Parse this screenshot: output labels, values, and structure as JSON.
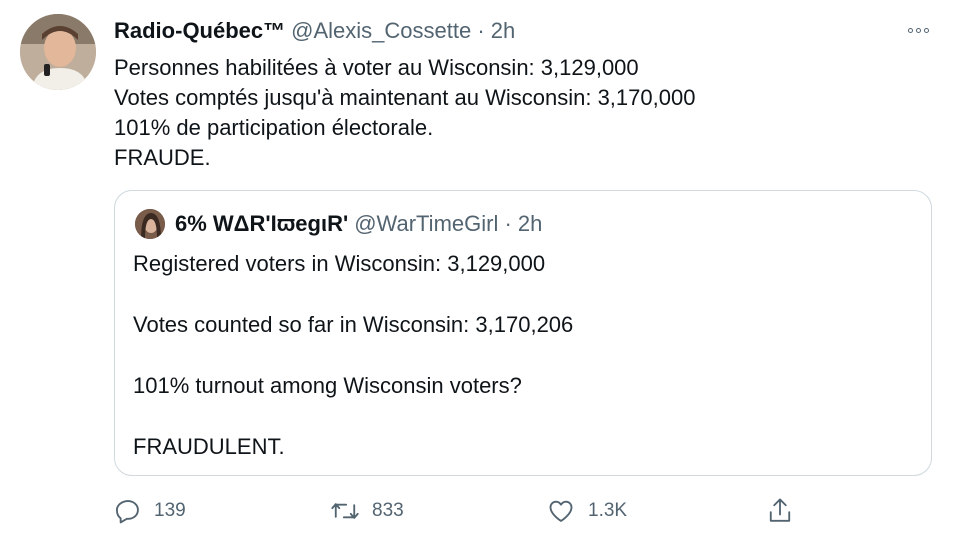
{
  "tweet": {
    "author_name": "Radio-Québec™",
    "handle_time": "@Alexis_Cossette · 2h",
    "text_lines": [
      "Personnes habilitées à voter au Wisconsin: 3,129,000",
      "Votes comptés jusqu'à maintenant au Wisconsin: 3,170,000",
      "101% de participation électorale.",
      "FRAUDE."
    ]
  },
  "quoted": {
    "author_name": "6% WΔR'IϖegιR'",
    "handle_time": "@WarTimeGirl · 2h",
    "lines": [
      "Registered voters in Wisconsin: 3,129,000",
      "Votes counted so far in Wisconsin: 3,170,206",
      "101% turnout among Wisconsin voters?",
      "FRAUDULENT."
    ]
  },
  "actions": {
    "reply_count": "139",
    "retweet_count": "833",
    "like_count": "1.3K"
  },
  "icons": {
    "more": "more-horizontal-icon",
    "reply": "reply-icon",
    "retweet": "retweet-icon",
    "like": "heart-icon",
    "share": "share-icon"
  }
}
